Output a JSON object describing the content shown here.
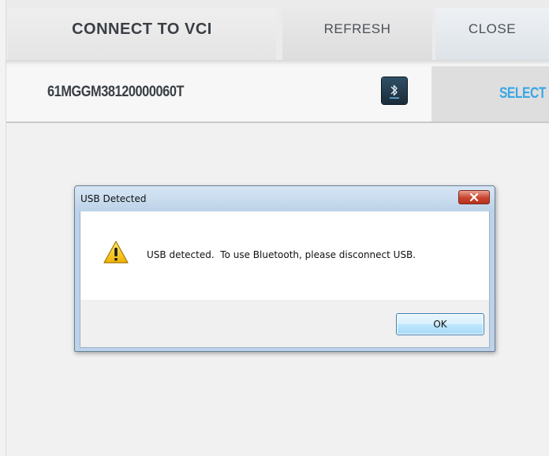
{
  "header": {
    "title": "CONNECT TO VCI",
    "refresh_label": "REFRESH",
    "close_label": "CLOSE"
  },
  "device": {
    "id": "61MGGM38120000060T",
    "connection_icon": "bluetooth-icon",
    "select_label": "SELECT"
  },
  "dialog": {
    "title": "USB Detected",
    "message": "USB detected.  To use Bluetooth, please disconnect USB.",
    "icon": "warning-icon",
    "ok_label": "OK"
  },
  "colors": {
    "select_accent": "#38a7e6",
    "dialog_close_red": "#c8442d",
    "warning_yellow": "#f5c400"
  }
}
